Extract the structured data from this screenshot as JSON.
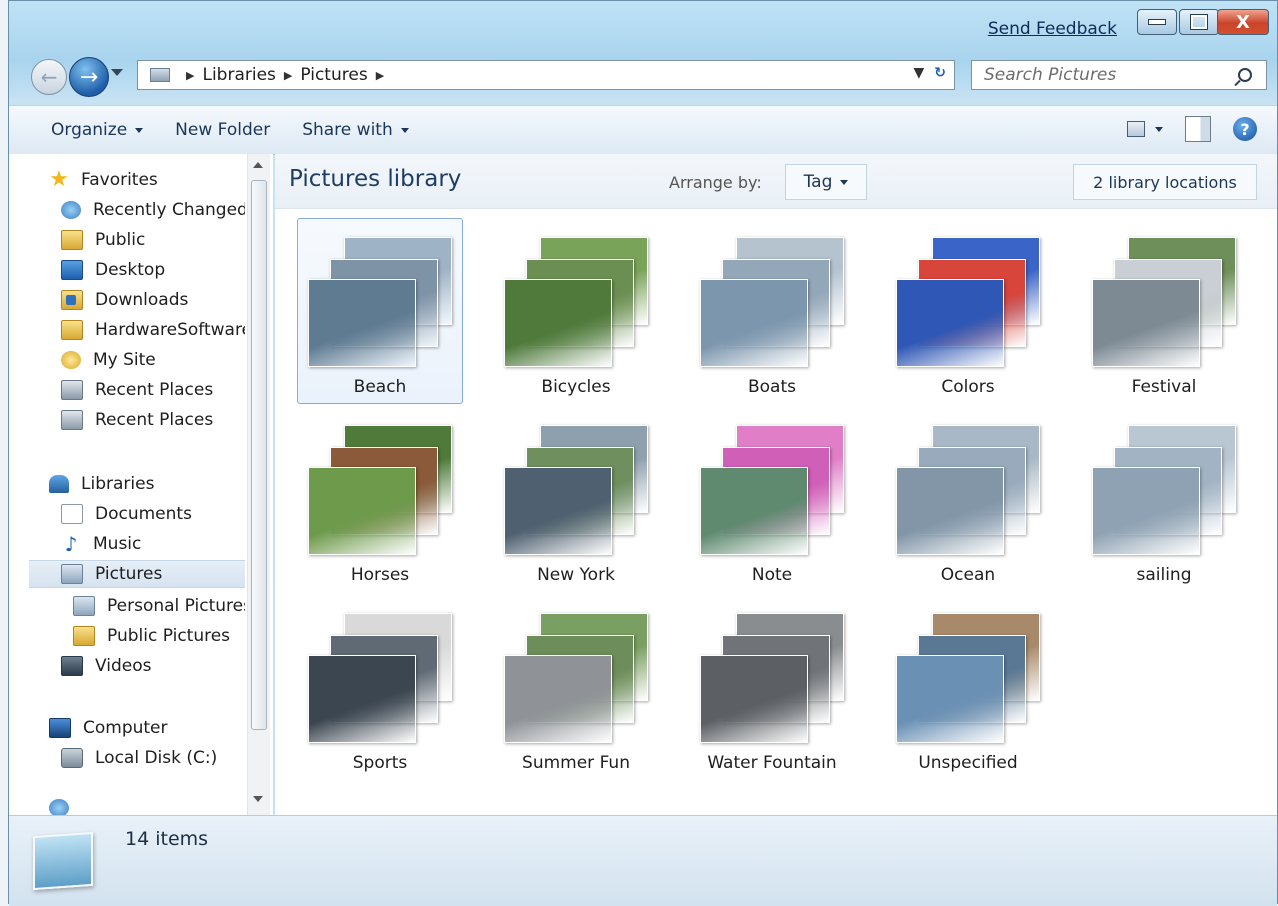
{
  "window": {
    "send_feedback": "Send Feedback",
    "close_glyph": "X"
  },
  "address": {
    "crumbs": [
      "Libraries",
      "Pictures"
    ],
    "refresh_glyph": "↻"
  },
  "search": {
    "placeholder": "Search Pictures"
  },
  "toolbar": {
    "organize": "Organize",
    "new_folder": "New Folder",
    "share_with": "Share with",
    "help_glyph": "?"
  },
  "nav": {
    "favorites_header": "Favorites",
    "favorites": [
      "Recently Changed",
      "Public",
      "Desktop",
      "Downloads",
      "HardwareSoftware",
      "My Site",
      "Recent Places",
      "Recent Places"
    ],
    "libraries_header": "Libraries",
    "libraries": [
      "Documents",
      "Music",
      "Pictures",
      "Personal Pictures",
      "Public Pictures",
      "Videos"
    ],
    "computer_header": "Computer",
    "computer": [
      "Local Disk (C:)"
    ]
  },
  "content": {
    "title": "Pictures library",
    "arrange_label": "Arrange by:",
    "arrange_value": "Tag",
    "locations": "2 library locations",
    "tiles": [
      {
        "label": "Beach",
        "colors": [
          "#9fb3c6",
          "#7f93a6",
          "#5f7b92"
        ]
      },
      {
        "label": "Bicycles",
        "colors": [
          "#7aa35a",
          "#6b8f52",
          "#4f7a3c"
        ]
      },
      {
        "label": "Boats",
        "colors": [
          "#b5c3cf",
          "#93a7b8",
          "#7c96ad"
        ]
      },
      {
        "label": "Colors",
        "colors": [
          "#3a64c8",
          "#d8453b",
          "#2f57b5"
        ]
      },
      {
        "label": "Festival",
        "colors": [
          "#6e8e5a",
          "#c9cfd4",
          "#7d8a94"
        ]
      },
      {
        "label": "Horses",
        "colors": [
          "#4f7a3a",
          "#8a5a3a",
          "#6e9a4c"
        ]
      },
      {
        "label": "New York",
        "colors": [
          "#8ea0ae",
          "#6f8f5f",
          "#4f6070"
        ]
      },
      {
        "label": "Note",
        "colors": [
          "#e07fc8",
          "#d05fb8",
          "#5f8a70"
        ]
      },
      {
        "label": "Ocean",
        "colors": [
          "#a8b8c6",
          "#98aabb",
          "#8296a8"
        ]
      },
      {
        "label": "sailing",
        "colors": [
          "#b9c7d3",
          "#a2b4c4",
          "#8fa2b3"
        ]
      },
      {
        "label": "Sports",
        "colors": [
          "#d9d9d9",
          "#606a74",
          "#3c4650"
        ]
      },
      {
        "label": "Summer Fun",
        "colors": [
          "#7a9f62",
          "#6d8d5a",
          "#8f9398"
        ]
      },
      {
        "label": "Water Fountain",
        "colors": [
          "#8a8d8f",
          "#707478",
          "#5c6064"
        ]
      },
      {
        "label": "Unspecified",
        "colors": [
          "#a88a6a",
          "#5a7894",
          "#6a90b4"
        ]
      }
    ]
  },
  "status": {
    "items": "14 items"
  }
}
